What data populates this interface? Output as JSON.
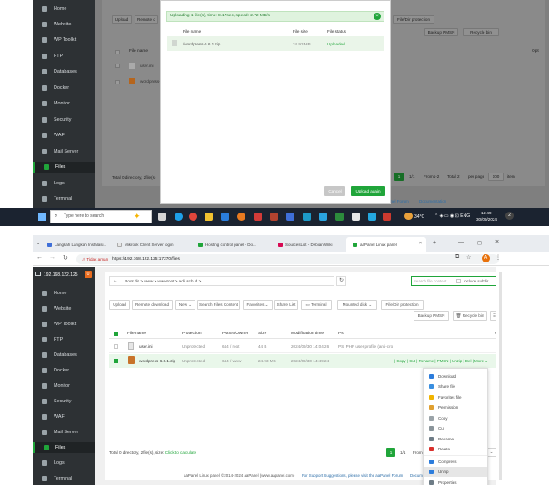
{
  "top": {
    "sidebar": [
      "Home",
      "Website",
      "WP Toolkit",
      "FTP",
      "Databases",
      "Docker",
      "Monitor",
      "Security",
      "WAF",
      "Mail Server",
      "Files",
      "Logs",
      "Terminal"
    ],
    "toolbar": {
      "upload": "Upload",
      "remote": "Remote d",
      "dir_protection": "File/Dir protection",
      "backup": "Backup PMSN",
      "recycle": "Recycle bin"
    },
    "table": {
      "col_file_name": "File name",
      "col_operation": "Opt",
      "rows": [
        "user.ini",
        "wordpress-"
      ]
    },
    "status": "Total 0 directory, 2file(s)",
    "pagination": {
      "current": "1",
      "total": "1/1",
      "from": "From1-2",
      "total_count": "Total 2",
      "per_page": "per page",
      "per_value": "100",
      "item": "item"
    },
    "footer": {
      "forum": "anel Forum",
      "documentation": "Documentation"
    },
    "dialog": {
      "banner": "Uploading 1 file(s), time: 8.17sec, speed: 2.72 MB/s",
      "col_name": "File name",
      "col_size": "File size",
      "col_status": "File status",
      "file": "/wordpress-6.6.1.zip",
      "size": "24.93 MB",
      "status": "Uploaded",
      "cancel": "Cancel",
      "upload_again": "Upload again"
    }
  },
  "taskbar": {
    "search": "Type here to search",
    "weather": "34°C",
    "time": "14:49",
    "date": "30/09/2024"
  },
  "browser": {
    "tabs": [
      "Langkah Langkah Instalasi...",
      "Mikrotik Client Server login",
      "Hosting control panel - Do...",
      "SourcesList - Debian Wiki",
      "aaPanel Linux panel"
    ],
    "not_secure": "Tidak aman",
    "url": "https://192.168.122.125:17270/files"
  },
  "panel": {
    "ip": "192.168.122.125",
    "badge": "0",
    "sidebar": [
      "Home",
      "Website",
      "WP Toolkit",
      "FTP",
      "Databases",
      "Docker",
      "Monitor",
      "Security",
      "WAF",
      "Mail Server",
      "Files",
      "Logs",
      "Terminal"
    ],
    "breadcrumb": [
      "Root dir",
      "www",
      "wwwroot",
      "adit.sch.id"
    ],
    "search_placeholder": "Search file content",
    "include_subdir": "Include subdir",
    "toolbar": [
      "Upload",
      "Remote download",
      "New",
      "Search Files Content",
      "Favorites",
      "Share List",
      "Terminal",
      "Mounted disk",
      "File/Dir protection"
    ],
    "backup": "Backup PMSN",
    "recycle": "Recycle bin",
    "headers": {
      "file_name": "File name",
      "protection": "Protection",
      "owner": "PMSN/Owner",
      "size": "Size",
      "mtime": "Modification time",
      "ps": "Ps",
      "operation": "Operation"
    },
    "rows": [
      {
        "name": "user.ini",
        "protection": "Unprotected",
        "owner": "644 / root",
        "size": "44 B",
        "mtime": "2024/09/30 14:04:26",
        "ps": "PS: PHP user profile (anti-cro"
      },
      {
        "name": "wordpress-6.6.1.zip",
        "protection": "Unprotected",
        "owner": "644 / www",
        "size": "24.93 MB",
        "mtime": "2024/09/30 14:49:24",
        "ps": ""
      }
    ],
    "row_actions": "| Copy | Cut | Rename | PMSN | Unzip | Del | More",
    "status": "Total 0 directory, 2file(s), size:",
    "calculate": "Click to calculate",
    "pagination": {
      "current": "1",
      "total": "1/1",
      "from": "From",
      "item": "item"
    },
    "footer": "aaPanel Linux panel ©2014-2024 aaPanel (www.aapanel.com)",
    "suggestions": "For Support Suggestions, please visit the aaPanel Forum",
    "docs": "Docum",
    "context_menu": [
      "Download",
      "Share file",
      "Favorites file",
      "Permission",
      "Copy",
      "Cut",
      "Rename",
      "Delete",
      "Compress",
      "Unzip",
      "Properties"
    ],
    "colors": {
      "accent": "#20a53a",
      "sidebar": "#2d3134",
      "taskbar": "#1b2330"
    }
  }
}
